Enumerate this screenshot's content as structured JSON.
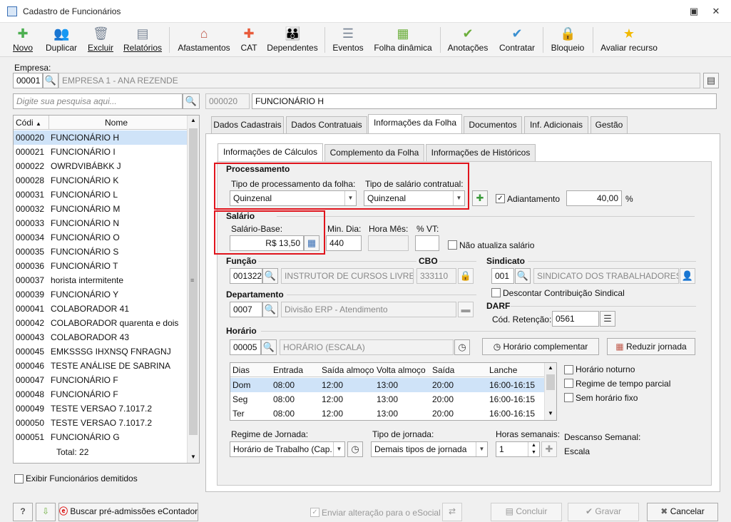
{
  "window": {
    "title": "Cadastro de Funcionários",
    "restore_icon": "restore-icon",
    "close_icon": "close-icon"
  },
  "toolbar": [
    {
      "label": "Novo",
      "icon": "new-user-icon"
    },
    {
      "label": "Duplicar",
      "icon": "duplicate-users-icon"
    },
    {
      "label": "Excluir",
      "icon": "trash-icon"
    },
    {
      "label": "Relatórios",
      "icon": "report-icon"
    },
    {
      "label": "Afastamentos",
      "icon": "house-arrow-icon"
    },
    {
      "label": "CAT",
      "icon": "medical-cross-icon"
    },
    {
      "label": "Dependentes",
      "icon": "family-icon"
    },
    {
      "label": "Eventos",
      "icon": "list-icon"
    },
    {
      "label": "Folha dinâmica",
      "icon": "calendar-icon"
    },
    {
      "label": "Anotações",
      "icon": "note-check-icon"
    },
    {
      "label": "Contratar",
      "icon": "contract-check-icon"
    },
    {
      "label": "Bloqueio",
      "icon": "lock-icon"
    },
    {
      "label": "Avaliar recurso",
      "icon": "star-icon"
    }
  ],
  "empresa": {
    "label": "Empresa:",
    "code": "00001",
    "name": "EMPRESA 1 - ANA REZENDE"
  },
  "search": {
    "placeholder": "Digite sua pesquisa aqui..."
  },
  "current": {
    "code": "000020",
    "name": "FUNCIONÁRIO H"
  },
  "list": {
    "headers": [
      "Códi",
      "Nome"
    ],
    "rows": [
      {
        "code": "000020",
        "name": "FUNCIONÁRIO H"
      },
      {
        "code": "000021",
        "name": "FUNCIONÁRIO I"
      },
      {
        "code": "000022",
        "name": "OWRDVIBÁBKK J"
      },
      {
        "code": "000028",
        "name": "FUNCIONÁRIO K"
      },
      {
        "code": "000031",
        "name": "FUNCIONÁRIO L"
      },
      {
        "code": "000032",
        "name": "FUNCIONÁRIO M"
      },
      {
        "code": "000033",
        "name": "FUNCIONÁRIO N"
      },
      {
        "code": "000034",
        "name": "FUNCIONÁRIO O"
      },
      {
        "code": "000035",
        "name": "FUNCIONÁRIO S"
      },
      {
        "code": "000036",
        "name": "FUNCIONÁRIO T"
      },
      {
        "code": "000037",
        "name": "horista intermitente"
      },
      {
        "code": "000039",
        "name": "FUNCIONÁRIO Y"
      },
      {
        "code": "000041",
        "name": "COLABORADOR 41"
      },
      {
        "code": "000042",
        "name": "COLABORADOR quarenta e dois"
      },
      {
        "code": "000043",
        "name": "COLABORADOR 43"
      },
      {
        "code": "000045",
        "name": "EMKSSSG IHXNSQ FNRAGNJ"
      },
      {
        "code": "000046",
        "name": "TESTE ANÁLISE DE SABRINA"
      },
      {
        "code": "000047",
        "name": "FUNCIONÁRIO F"
      },
      {
        "code": "000048",
        "name": "FUNCIONÁRIO F"
      },
      {
        "code": "000049",
        "name": "TESTE VERSAO 7.1017.2"
      },
      {
        "code": "000050",
        "name": "TESTE VERSAO 7.1017.2"
      },
      {
        "code": "000051",
        "name": "FUNCIONÁRIO G"
      }
    ],
    "total": "Total: 22"
  },
  "exibir_demitidos": "Exibir Funcionários demitidos",
  "tabs": [
    "Dados Cadastrais",
    "Dados Contratuais",
    "Informações da Folha",
    "Documentos",
    "Inf. Adicionais",
    "Gestão"
  ],
  "subtabs": [
    "Informações de Cálculos",
    "Complemento da Folha",
    "Informações de Históricos"
  ],
  "processamento": {
    "title": "Processamento",
    "tipo_proc_label": "Tipo de processamento da folha:",
    "tipo_proc_value": "Quinzenal",
    "tipo_sal_label": "Tipo de salário contratual:",
    "tipo_sal_value": "Quinzenal",
    "adiantamento_label": "Adiantamento",
    "adiantamento_value": "40,00",
    "percent": "%"
  },
  "salario": {
    "title": "Salário",
    "base_label": "Salário-Base:",
    "base_value": "R$ 13,50",
    "min_dia_label": "Min. Dia:",
    "min_dia_value": "440",
    "hora_mes_label": "Hora Mês:",
    "vt_label": "% VT:",
    "nao_atualiza": "Não atualiza salário"
  },
  "funcao": {
    "title": "Função",
    "code": "001322",
    "name": "INSTRUTOR DE CURSOS LIVRES"
  },
  "cbo": {
    "title": "CBO",
    "value": "333110"
  },
  "sindicato": {
    "title": "Sindicato",
    "code": "001",
    "name": "SINDICATO DOS TRABALHADORES DA",
    "descontar": "Descontar Contribuição Sindical"
  },
  "departamento": {
    "title": "Departamento",
    "code": "0007",
    "name": "Divisão ERP - Atendimento"
  },
  "darf": {
    "title": "DARF",
    "label": "Cód. Retenção:",
    "value": "0561"
  },
  "horario": {
    "title": "Horário",
    "code": "00005",
    "name": "HORÁRIO (ESCALA)",
    "complementar": "Horário complementar",
    "reduzir": "Reduzir jornada",
    "headers": [
      "Dias",
      "Entrada",
      "Saída almoço",
      "Volta almoço",
      "Saída",
      "Lanche"
    ],
    "rows": [
      [
        "Dom",
        "08:00",
        "12:00",
        "13:00",
        "20:00",
        "16:00-16:15"
      ],
      [
        "Seg",
        "08:00",
        "12:00",
        "13:00",
        "20:00",
        "16:00-16:15"
      ],
      [
        "Ter",
        "08:00",
        "12:00",
        "13:00",
        "20:00",
        "16:00-16:15"
      ]
    ],
    "noturno": "Horário noturno",
    "parcial": "Regime de tempo parcial",
    "sem_fixo": "Sem horário fixo"
  },
  "regime": {
    "regime_label": "Regime de Jornada:",
    "regime_value": "Horário de Trabalho (Cap.",
    "tipo_label": "Tipo de jornada:",
    "tipo_value": "Demais tipos de jornada",
    "horas_label": "Horas semanais:",
    "horas_value": "1",
    "descanso_label": "Descanso Semanal:",
    "descanso_value": "Escala"
  },
  "footer": {
    "buscar": "Buscar pré-admissões eContador",
    "esocial": "Enviar alteração para o eSocial",
    "concluir": "Concluir",
    "gravar": "Gravar",
    "cancelar": "Cancelar"
  }
}
